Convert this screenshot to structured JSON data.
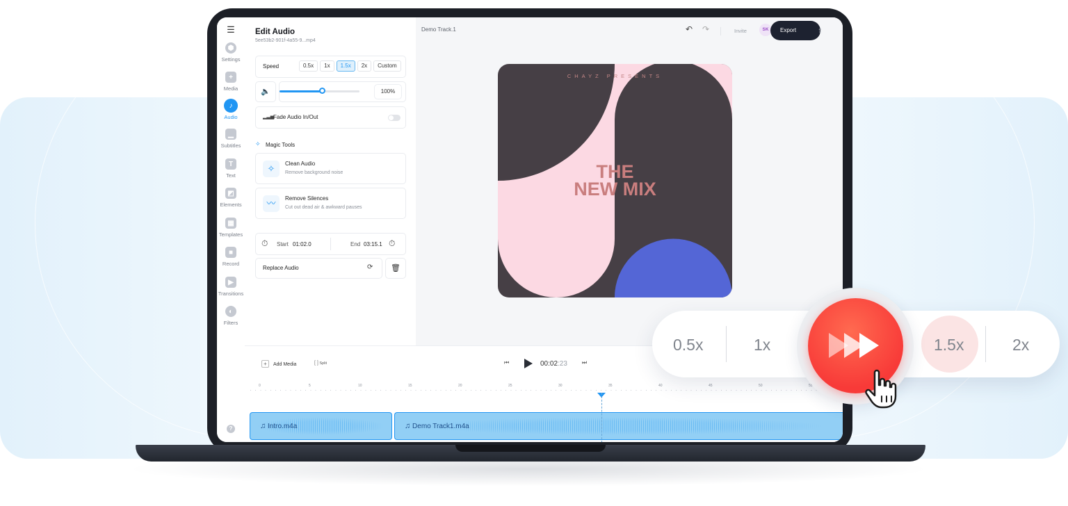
{
  "sidebar": {
    "items": [
      {
        "label": "Settings",
        "icon": "settings-icon"
      },
      {
        "label": "Media",
        "icon": "plus-icon"
      },
      {
        "label": "Audio",
        "icon": "music-note-icon",
        "active": true
      },
      {
        "label": "Subtitles",
        "icon": "subtitles-icon"
      },
      {
        "label": "Text",
        "icon": "text-icon"
      },
      {
        "label": "Elements",
        "icon": "elements-icon"
      },
      {
        "label": "Templates",
        "icon": "templates-icon"
      },
      {
        "label": "Record",
        "icon": "record-icon"
      },
      {
        "label": "Transitions",
        "icon": "transitions-icon"
      },
      {
        "label": "Filters",
        "icon": "filters-icon"
      }
    ]
  },
  "panel": {
    "title": "Edit Audio",
    "filename": "5ee53b2-901f-4a55-9...mp4",
    "speed_label": "Speed",
    "speed_options": [
      "0.5x",
      "1x",
      "1.5x",
      "2x",
      "Custom"
    ],
    "speed_selected": "1.5x",
    "volume_value": "100%",
    "volume_level": 0.53,
    "fade_label": "Fade Audio In/Out",
    "fade_enabled": false,
    "magic_tools_label": "Magic Tools",
    "tools": [
      {
        "title": "Clean Audio",
        "subtitle": "Remove background noise"
      },
      {
        "title": "Remove Silences",
        "subtitle": "Cut out dead air & awkward pauses"
      }
    ],
    "start_label": "Start",
    "start_value": "01:02.0",
    "end_label": "End",
    "end_value": "03:15.1",
    "replace_label": "Replace Audio"
  },
  "topbar": {
    "track_name": "Demo Track.1",
    "invite_label": "Invite",
    "avatar_initials": "SK",
    "export_label": "Export"
  },
  "cover": {
    "presents": "CHAYZ PRESENTS",
    "title_line1": "THE",
    "title_line2": "NEW MIX",
    "colors": {
      "dark": "#463f45",
      "pink": "#fcd9e3",
      "blue": "#5466d6",
      "title": "#c97e7e"
    }
  },
  "timeline": {
    "add_media_label": "Add Media",
    "split_label": "Split",
    "time_main": "00:02",
    "time_frames": ":23",
    "ruler_ticks": [
      "0",
      "5",
      "10",
      "15",
      "20",
      "25",
      "30",
      "35",
      "40",
      "45",
      "50",
      "55"
    ],
    "clips": [
      {
        "name": "Intro.m4a"
      },
      {
        "name": "Demo Track1.m4a"
      }
    ]
  },
  "overlay": {
    "speeds": [
      "0.5x",
      "1x",
      "1.5x",
      "2x"
    ],
    "selected": "1.5x",
    "button_icon": "fast-forward-icon",
    "accent": "#f83a38"
  }
}
